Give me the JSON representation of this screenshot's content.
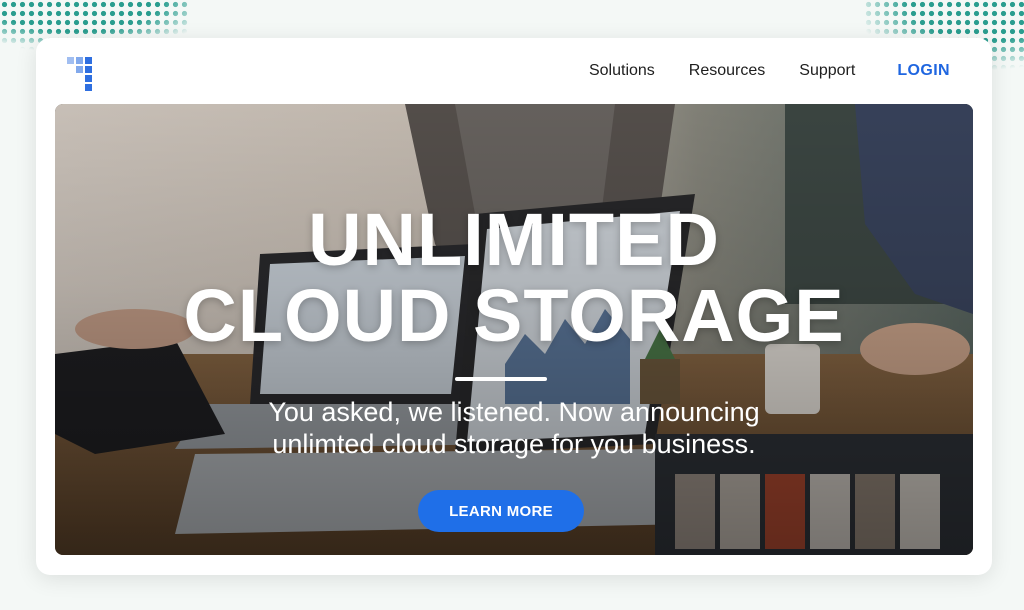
{
  "nav": {
    "items": [
      "Solutions",
      "Resources",
      "Support"
    ],
    "login_label": "LOGIN"
  },
  "hero": {
    "headline_line1": "UNLIMITED",
    "headline_line2": "CLOUD STORAGE",
    "subtext_line1": "You asked, we listened. Now announcing",
    "subtext_line2": "unlimted cloud storage for you business.",
    "cta_label": "LEARN MORE"
  },
  "colors": {
    "accent": "#1f6fe8",
    "login": "#1f66e0",
    "decor_dots": "#2a9d8f"
  },
  "icons": {
    "logo": "logo-icon"
  }
}
